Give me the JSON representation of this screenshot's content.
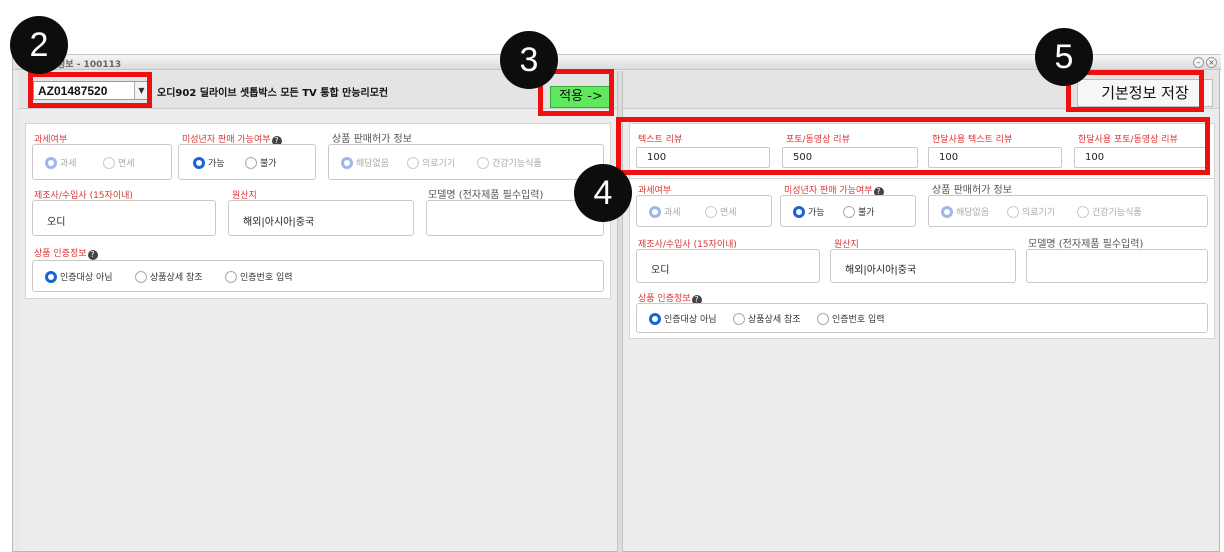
{
  "window": {
    "title": "정보 - 100113",
    "minimize_glyph": "–",
    "close_glyph": "×"
  },
  "left": {
    "product_code": "AZ01487520",
    "dropdown_glyph": "▼",
    "product_name": "오디902 딜라이브 셋톱박스 모든 TV 통합 만능리모컨",
    "apply_label": "적용 ->"
  },
  "right": {
    "save_label": "기본정보 저장",
    "reviews": [
      {
        "label": "텍스트 리뷰",
        "value": "100"
      },
      {
        "label": "포토/동영상 리뷰",
        "value": "500"
      },
      {
        "label": "한달사용 텍스트 리뷰",
        "value": "100"
      },
      {
        "label": "한달사용 포토/동영상 리뷰",
        "value": "100"
      }
    ]
  },
  "form_left": {
    "tax_label": "과세여부",
    "tax_options": [
      "과세",
      "면세"
    ],
    "minor_label": "미성년자 판매 가능여부",
    "minor_options": [
      "가능",
      "불가"
    ],
    "permit_label": "상품 판매허가 정보",
    "permit_options": [
      "해당없음",
      "의료기기",
      "건강기능식품"
    ],
    "maker_label": "제조사/수입사 (15자이내)",
    "maker_value": "오디",
    "origin_label": "원산지",
    "origin_value": "해외|아시아|중국",
    "model_label": "모델명 (전자제품 필수입력)",
    "model_value": "",
    "cert_label": "상품 인증정보",
    "cert_options": [
      "인증대상 아님",
      "상품상세 참조",
      "인증번호 입력"
    ]
  },
  "form_right": {
    "tax_label": "과세여부",
    "tax_options": [
      "과세",
      "면세"
    ],
    "minor_label": "미성년자 판매 가능여부",
    "minor_options": [
      "가능",
      "불가"
    ],
    "permit_label": "상품 판매허가 정보",
    "permit_options": [
      "해당없음",
      "의료기기",
      "건강기능식품"
    ],
    "maker_label": "제조사/수입사 (15자이내)",
    "maker_value": "오디",
    "origin_label": "원산지",
    "origin_value": "해외|아시아|중국",
    "model_label": "모델명 (전자제품 필수입력)",
    "model_value": "",
    "cert_label": "상품 인증정보",
    "cert_options": [
      "인증대상 아님",
      "상품상세 참조",
      "인증번호 입력"
    ]
  },
  "help_glyph": "?",
  "badges": [
    "2",
    "3",
    "4",
    "5"
  ],
  "colors": {
    "highlight": "#ee0f0f",
    "apply_button": "#5ee85e",
    "radio_selected": "#1a63d6",
    "label_red": "#d33333"
  }
}
